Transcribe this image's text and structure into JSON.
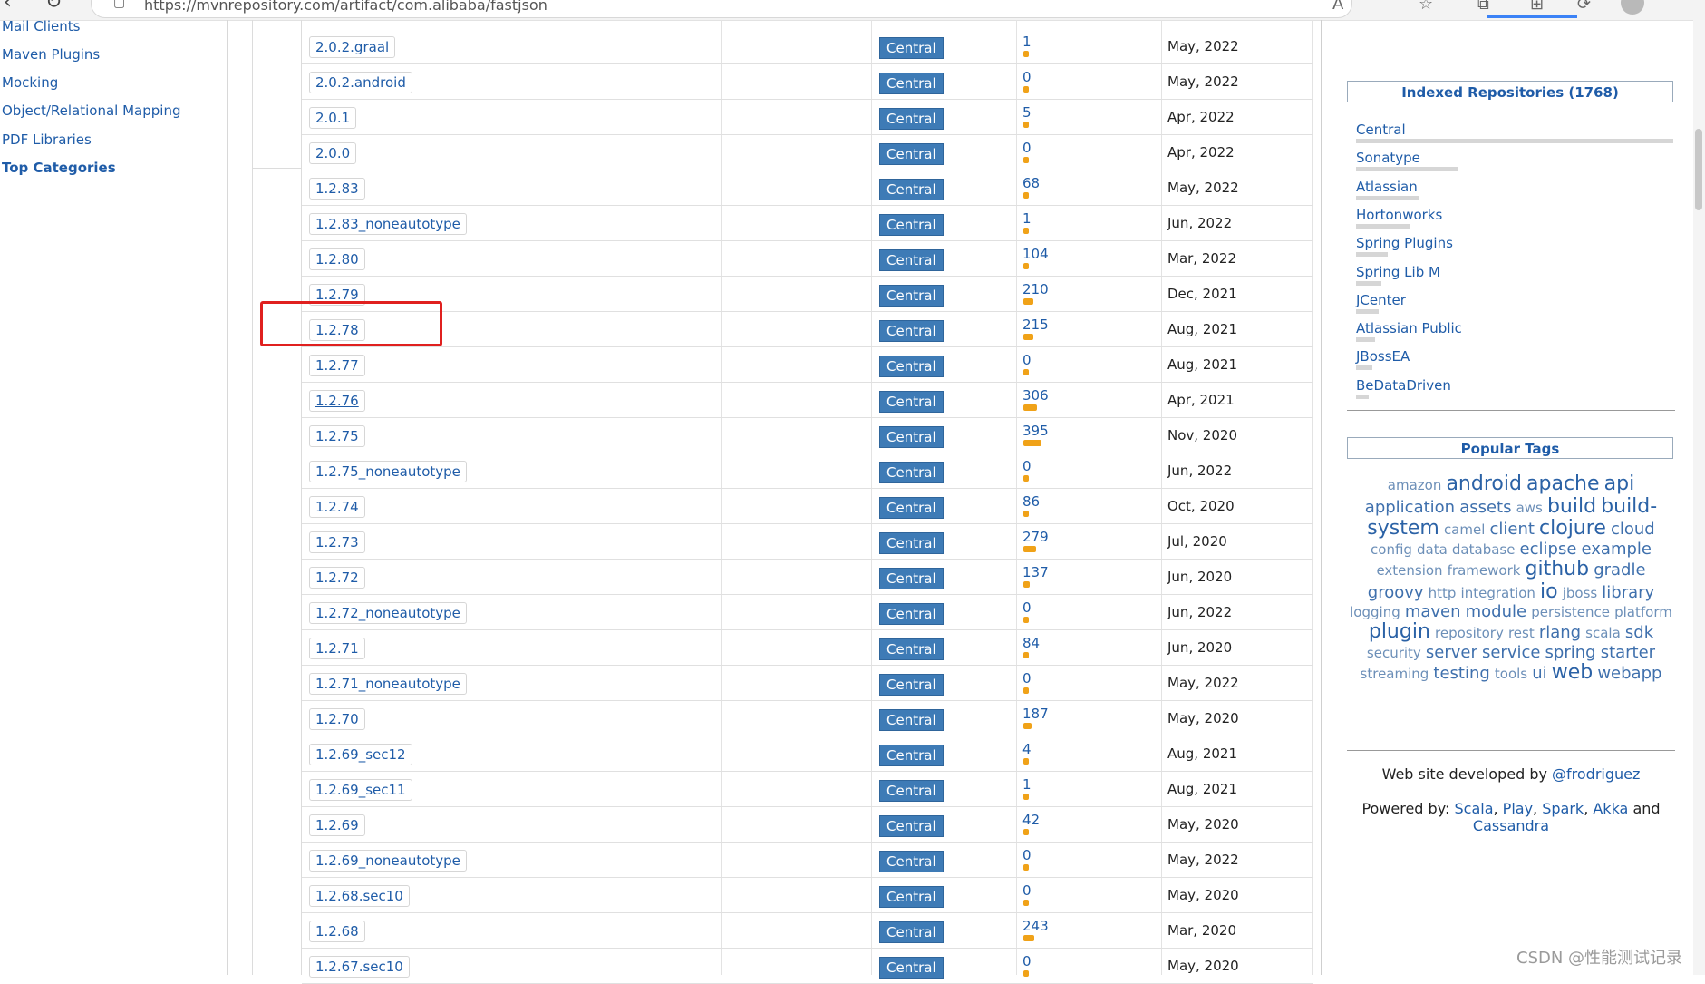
{
  "browser": {
    "url": "https://mvnrepository.com/artifact/com.alibaba/fastjson"
  },
  "left_sidebar": {
    "categories": [
      "Mail Clients",
      "Maven Plugins",
      "Mocking",
      "Object/Relational Mapping",
      "PDF Libraries"
    ],
    "top_categories_label": "Top Categories"
  },
  "versions": {
    "repository_label": "Central",
    "rows": [
      {
        "version": "2.0.2.graal",
        "usages": "1",
        "date": "May, 2022",
        "usage_bar": 0.02
      },
      {
        "version": "2.0.2.android",
        "usages": "0",
        "date": "May, 2022",
        "usage_bar": 0.01
      },
      {
        "version": "2.0.1",
        "usages": "5",
        "date": "Apr, 2022",
        "usage_bar": 0.02
      },
      {
        "version": "2.0.0",
        "usages": "0",
        "date": "Apr, 2022",
        "usage_bar": 0.01
      },
      {
        "version": "1.2.83",
        "usages": "68",
        "date": "May, 2022",
        "usage_bar": 0.17
      },
      {
        "version": "1.2.83_noneautotype",
        "usages": "1",
        "date": "Jun, 2022",
        "usage_bar": 0.02
      },
      {
        "version": "1.2.80",
        "usages": "104",
        "date": "Mar, 2022",
        "usage_bar": 0.26
      },
      {
        "version": "1.2.79",
        "usages": "210",
        "date": "Dec, 2021",
        "usage_bar": 0.53
      },
      {
        "version": "1.2.78",
        "usages": "215",
        "date": "Aug, 2021",
        "usage_bar": 0.54
      },
      {
        "version": "1.2.77",
        "usages": "0",
        "date": "Aug, 2021",
        "usage_bar": 0.01
      },
      {
        "version": "1.2.76",
        "usages": "306",
        "date": "Apr, 2021",
        "usage_bar": 0.77
      },
      {
        "version": "1.2.75",
        "usages": "395",
        "date": "Nov, 2020",
        "usage_bar": 1.0
      },
      {
        "version": "1.2.75_noneautotype",
        "usages": "0",
        "date": "Jun, 2022",
        "usage_bar": 0.01
      },
      {
        "version": "1.2.74",
        "usages": "86",
        "date": "Oct, 2020",
        "usage_bar": 0.22
      },
      {
        "version": "1.2.73",
        "usages": "279",
        "date": "Jul, 2020",
        "usage_bar": 0.71
      },
      {
        "version": "1.2.72",
        "usages": "137",
        "date": "Jun, 2020",
        "usage_bar": 0.35
      },
      {
        "version": "1.2.72_noneautotype",
        "usages": "0",
        "date": "Jun, 2022",
        "usage_bar": 0.01
      },
      {
        "version": "1.2.71",
        "usages": "84",
        "date": "Jun, 2020",
        "usage_bar": 0.21
      },
      {
        "version": "1.2.71_noneautotype",
        "usages": "0",
        "date": "May, 2022",
        "usage_bar": 0.01
      },
      {
        "version": "1.2.70",
        "usages": "187",
        "date": "May, 2020",
        "usage_bar": 0.47
      },
      {
        "version": "1.2.69_sec12",
        "usages": "4",
        "date": "Aug, 2021",
        "usage_bar": 0.02
      },
      {
        "version": "1.2.69_sec11",
        "usages": "1",
        "date": "Aug, 2021",
        "usage_bar": 0.02
      },
      {
        "version": "1.2.69",
        "usages": "42",
        "date": "May, 2020",
        "usage_bar": 0.11
      },
      {
        "version": "1.2.69_noneautotype",
        "usages": "0",
        "date": "May, 2022",
        "usage_bar": 0.01
      },
      {
        "version": "1.2.68.sec10",
        "usages": "0",
        "date": "May, 2020",
        "usage_bar": 0.01
      },
      {
        "version": "1.2.68",
        "usages": "243",
        "date": "Mar, 2020",
        "usage_bar": 0.62
      },
      {
        "version": "1.2.67.sec10",
        "usages": "0",
        "date": "May, 2020",
        "usage_bar": 0.01
      }
    ]
  },
  "right_sidebar": {
    "indexed_title": "Indexed Repositories (1768)",
    "repos": [
      {
        "name": "Central",
        "bar": 1.0
      },
      {
        "name": "Sonatype",
        "bar": 0.32
      },
      {
        "name": "Atlassian",
        "bar": 0.2
      },
      {
        "name": "Hortonworks",
        "bar": 0.17
      },
      {
        "name": "Spring Plugins",
        "bar": 0.1
      },
      {
        "name": "Spring Lib M",
        "bar": 0.08
      },
      {
        "name": "JCenter",
        "bar": 0.07
      },
      {
        "name": "Atlassian Public",
        "bar": 0.06
      },
      {
        "name": "JBossEA",
        "bar": 0.05
      },
      {
        "name": "BeDataDriven",
        "bar": 0.04
      }
    ],
    "tags_title": "Popular Tags",
    "tags": [
      {
        "t": "amazon",
        "s": 1
      },
      {
        "t": "android",
        "s": 3
      },
      {
        "t": "apache",
        "s": 3
      },
      {
        "t": "api",
        "s": 3
      },
      {
        "t": "application",
        "s": 2
      },
      {
        "t": "assets",
        "s": 2
      },
      {
        "t": "aws",
        "s": 1
      },
      {
        "t": "build",
        "s": 3
      },
      {
        "t": "build-system",
        "s": 3
      },
      {
        "t": "camel",
        "s": 1
      },
      {
        "t": "client",
        "s": 2
      },
      {
        "t": "clojure",
        "s": 3
      },
      {
        "t": "cloud",
        "s": 2
      },
      {
        "t": "config",
        "s": 1
      },
      {
        "t": "data",
        "s": 1
      },
      {
        "t": "database",
        "s": 1
      },
      {
        "t": "eclipse",
        "s": 2
      },
      {
        "t": "example",
        "s": 2
      },
      {
        "t": "extension",
        "s": 1
      },
      {
        "t": "framework",
        "s": 1
      },
      {
        "t": "github",
        "s": 3
      },
      {
        "t": "gradle",
        "s": 2
      },
      {
        "t": "groovy",
        "s": 2
      },
      {
        "t": "http",
        "s": 1
      },
      {
        "t": "integration",
        "s": 1
      },
      {
        "t": "io",
        "s": 3
      },
      {
        "t": "jboss",
        "s": 1
      },
      {
        "t": "library",
        "s": 2
      },
      {
        "t": "logging",
        "s": 1
      },
      {
        "t": "maven",
        "s": 2
      },
      {
        "t": "module",
        "s": 2
      },
      {
        "t": "persistence",
        "s": 1
      },
      {
        "t": "platform",
        "s": 1
      },
      {
        "t": "plugin",
        "s": 3
      },
      {
        "t": "repository",
        "s": 1
      },
      {
        "t": "rest",
        "s": 1
      },
      {
        "t": "rlang",
        "s": 2
      },
      {
        "t": "scala",
        "s": 1
      },
      {
        "t": "sdk",
        "s": 2
      },
      {
        "t": "security",
        "s": 1
      },
      {
        "t": "server",
        "s": 2
      },
      {
        "t": "service",
        "s": 2
      },
      {
        "t": "spring",
        "s": 2
      },
      {
        "t": "starter",
        "s": 2
      },
      {
        "t": "streaming",
        "s": 1
      },
      {
        "t": "testing",
        "s": 2
      },
      {
        "t": "tools",
        "s": 1
      },
      {
        "t": "ui",
        "s": 2
      },
      {
        "t": "web",
        "s": 3
      },
      {
        "t": "webapp",
        "s": 2
      }
    ],
    "dev_prefix": "Web site developed by ",
    "dev_handle": "@frodriguez",
    "powered_prefix": "Powered by: ",
    "powered_links": [
      "Scala",
      "Play",
      "Spark",
      "Akka"
    ],
    "powered_and": " and ",
    "powered_last": "Cassandra"
  },
  "watermark": "CSDN @性能测试记录"
}
